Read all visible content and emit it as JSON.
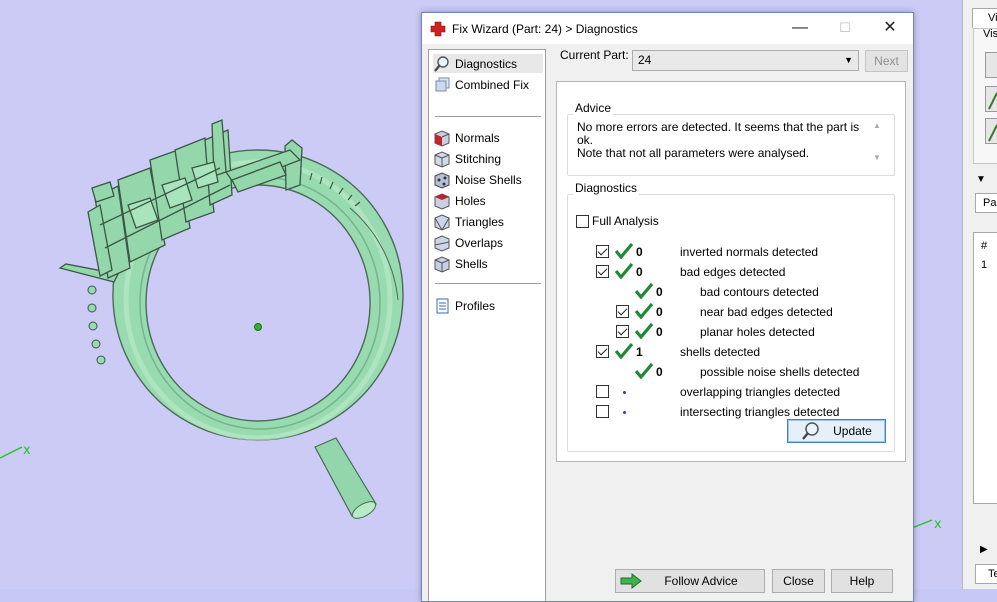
{
  "dialog": {
    "title": "Fix Wizard (Part: 24) > Diagnostics",
    "minimize_glyph": "—",
    "maximize_glyph": "☐",
    "close_glyph": "✕"
  },
  "nav": {
    "items": [
      {
        "label": "Diagnostics",
        "icon": "magnifier-icon"
      },
      {
        "label": "Combined Fix",
        "icon": "cube-stack-icon"
      },
      {
        "label": "Normals",
        "icon": "red-cube-icon"
      },
      {
        "label": "Stitching",
        "icon": "stitch-cube-icon"
      },
      {
        "label": "Noise Shells",
        "icon": "noise-cube-icon"
      },
      {
        "label": "Holes",
        "icon": "hole-cube-icon"
      },
      {
        "label": "Triangles",
        "icon": "triangle-cube-icon"
      },
      {
        "label": "Overlaps",
        "icon": "overlap-cube-icon"
      },
      {
        "label": "Shells",
        "icon": "shell-cube-icon"
      },
      {
        "label": "Profiles",
        "icon": "document-icon"
      }
    ]
  },
  "current_part": {
    "label": "Current Part:",
    "value": "24",
    "next_label": "Next"
  },
  "advice": {
    "title": "Advice",
    "line1": "No more errors are detected. It seems that the part is ok.",
    "line2": "Note that not all parameters were analysed."
  },
  "diagnostics": {
    "title": "Diagnostics",
    "full_analysis_label": "Full Analysis",
    "rows": [
      {
        "count": "0",
        "label": "inverted normals detected"
      },
      {
        "count": "0",
        "label": "bad edges detected"
      },
      {
        "count": "0",
        "label": "bad contours detected"
      },
      {
        "count": "0",
        "label": "near bad edges detected"
      },
      {
        "count": "0",
        "label": "planar holes detected"
      },
      {
        "count": "1",
        "label": "shells detected"
      },
      {
        "count": "0",
        "label": "possible noise shells detected"
      },
      {
        "count": "",
        "label": "overlapping triangles detected"
      },
      {
        "count": "",
        "label": "intersecting triangles detected"
      }
    ],
    "update_label": "Update"
  },
  "buttons": {
    "follow_advice": "Follow Advice",
    "close": "Close",
    "help": "Help"
  },
  "viewport": {
    "axis_x_left": "x",
    "axis_x_right": "x"
  },
  "right_panel": {
    "tab_top": "Vi",
    "box_label": "Vis",
    "tab_mid": "Par",
    "hash": "#",
    "row_one": "1",
    "tab_bottom": "Te"
  },
  "colors": {
    "viewport_bg": "#cbcbf6",
    "ring_green": "#99ddb1",
    "tick_green": "#1e8a35",
    "dot_blue": "#2a3bd1"
  }
}
